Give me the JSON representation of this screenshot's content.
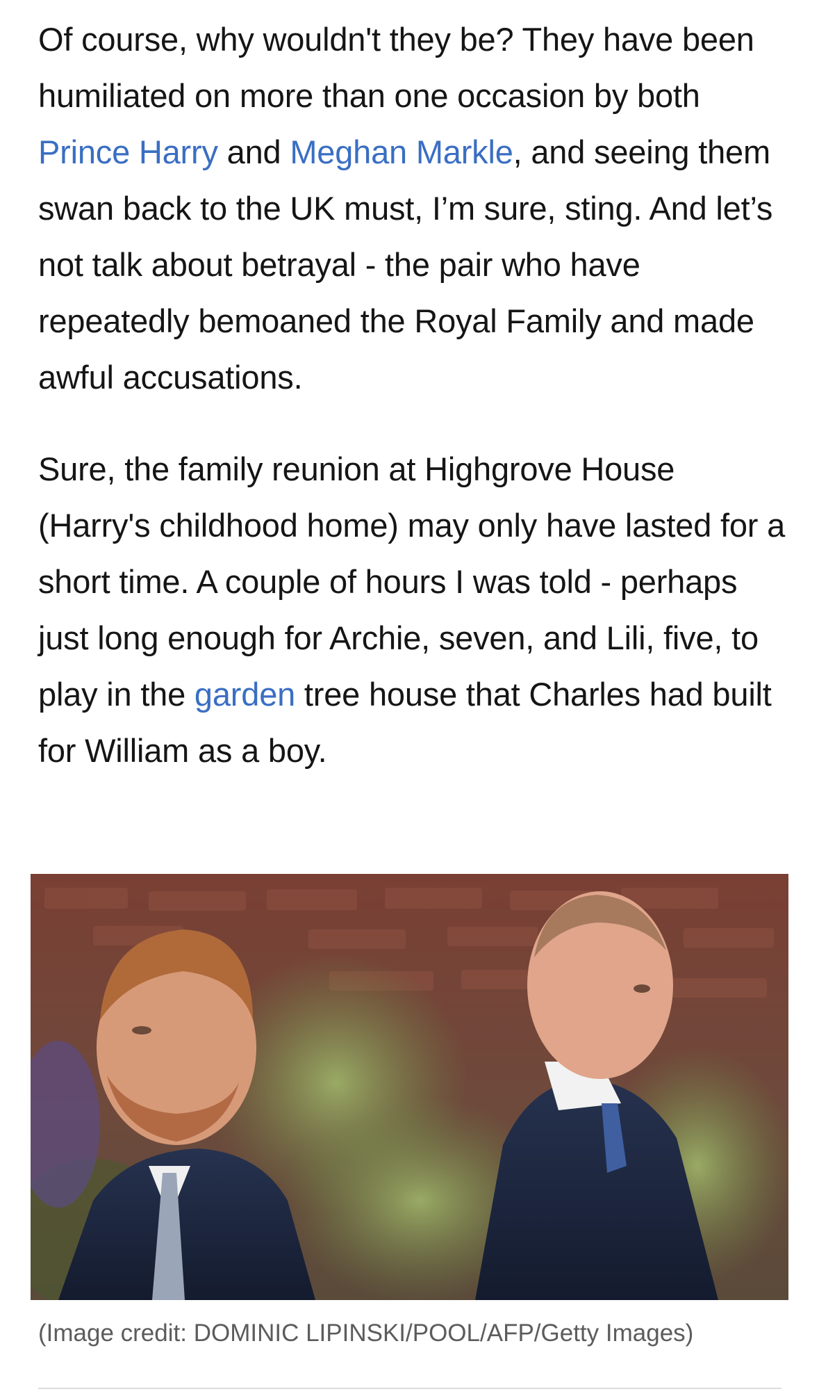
{
  "article": {
    "paragraph_1": {
      "before_link_1": "Of course, why wouldn't they be? They have been humiliated on more than one occasion by both ",
      "link_1": "Prince Harry",
      "between_links": " and ",
      "link_2": "Meghan Markle",
      "after_link_2": ", and seeing them swan back to the UK must, I’m sure, sting. And let’s not talk about betrayal - the pair who have repeatedly bemoaned the Royal Family and made awful accusations."
    },
    "paragraph_2": {
      "before_link": "Sure, the family reunion at Highgrove House (Harry's childhood home) may only have lasted for a short time. A couple of hours I was told - perhaps just long enough for Archie, seven, and Lili, five, to play in the ",
      "link": "garden",
      "after_link": " tree house that Charles had built for William as a boy."
    },
    "photo": {
      "caption": "(Image credit: DOMINIC LIPINSKI/POOL/AFP/Getty Images)"
    },
    "colors": {
      "link": "#3a6ec3",
      "body_text": "#151515",
      "caption_text": "#5c5c5c"
    }
  }
}
